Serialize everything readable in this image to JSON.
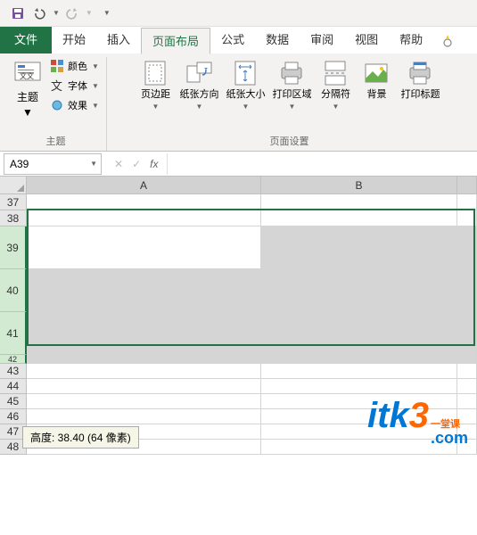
{
  "qat": {
    "save": "save",
    "undo": "undo",
    "redo": "redo"
  },
  "tabs": {
    "file": "文件",
    "home": "开始",
    "insert": "插入",
    "page_layout": "页面布局",
    "formulas": "公式",
    "data": "数据",
    "review": "审阅",
    "view": "视图",
    "help": "帮助"
  },
  "ribbon": {
    "themes_group": {
      "theme": "主题",
      "colors": "颜色",
      "fonts": "字体",
      "effects": "效果",
      "label": "主题"
    },
    "page_setup_group": {
      "margins": "页边距",
      "orientation": "纸张方向",
      "size": "纸张大小",
      "print_area": "打印区域",
      "breaks": "分隔符",
      "background": "背景",
      "print_titles": "打印标题",
      "label": "页面设置"
    }
  },
  "name_box": "A39",
  "columns": [
    "A",
    "B"
  ],
  "rows": [
    37,
    38,
    39,
    40,
    41,
    42,
    43,
    44,
    45,
    46,
    47,
    48
  ],
  "tooltip": "高度: 38.40 (64 像素)",
  "watermark": {
    "itk": "itk",
    "three": "3",
    "yi": "一堂课",
    "dotcom": ".com"
  }
}
